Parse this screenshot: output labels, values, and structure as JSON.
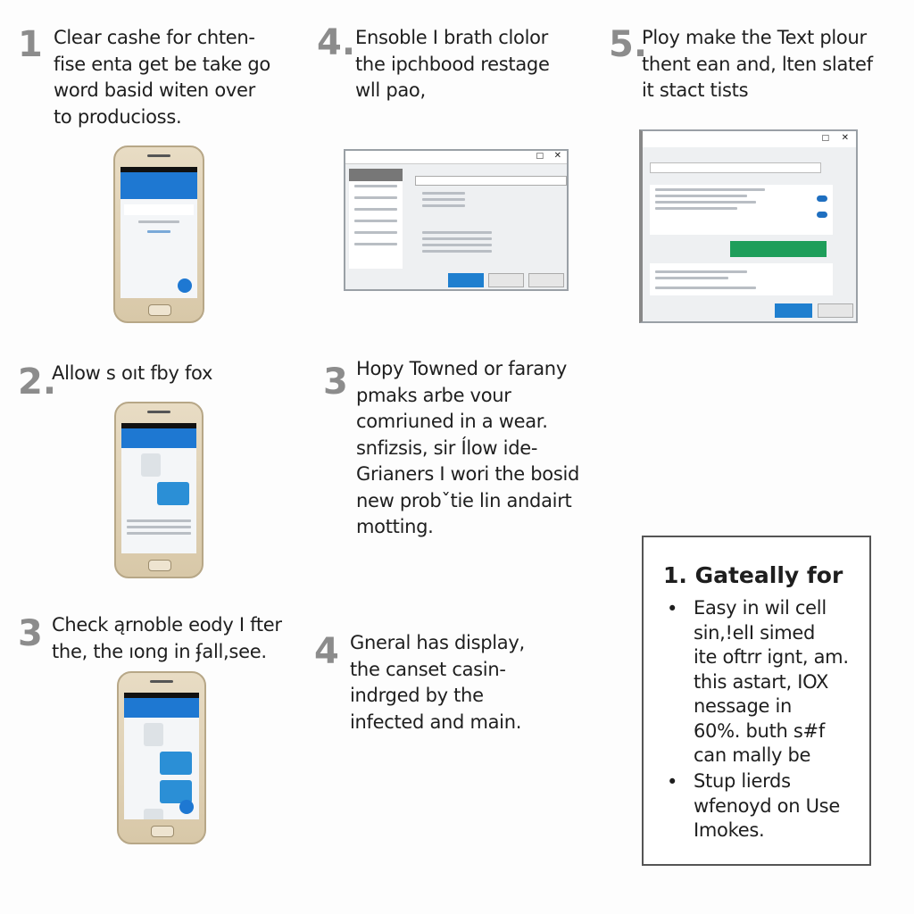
{
  "steps_top": [
    {
      "number": "1",
      "text": "Clear cashe for chten-\nfise enta get be take go\nword basid witen over\nto producioss."
    },
    {
      "number": "4.",
      "text": "Ensoble I brath clolor\nthe ipchbood restage\nwll pao,"
    },
    {
      "number": "5.",
      "text": "Ploy make the Text plour\nthent ean and, lten slatef\nit stact tists"
    }
  ],
  "steps_middle": [
    {
      "number": "2.",
      "text": "Allow s oıt fby fox"
    },
    {
      "number": "3",
      "text": "Hopy Towned or farany\npmaks arbe vour\ncomriuned in a wear.\nsnfizsis, sir Ílow ide-\nGrianers I wori the bosid\nnew probˇtie lin andairt\nmotting."
    }
  ],
  "steps_bottom": [
    {
      "number": "3",
      "text": "Check ąrnoble eody I fter\nthe, the ıong in ʄall,see."
    },
    {
      "number": "4",
      "text": "Gneral has display,\nthe canset casin-\nindrged by the\ninfected and main."
    }
  ],
  "info_box": {
    "heading": "1. Gateally for",
    "bullets": [
      "Easy in wil cell\nsin,!elI simed\nite oftrr ignt, am.\nthis astart, IOX\nnessage in\n60%. buth s#f\ncan mally be",
      "Stup lierds\nwfenoyd on Use\nImokes."
    ]
  },
  "colors": {
    "accent": "#1e78d2",
    "green_notice": "#1e9e5a",
    "step_number": "#8c8c8c"
  }
}
